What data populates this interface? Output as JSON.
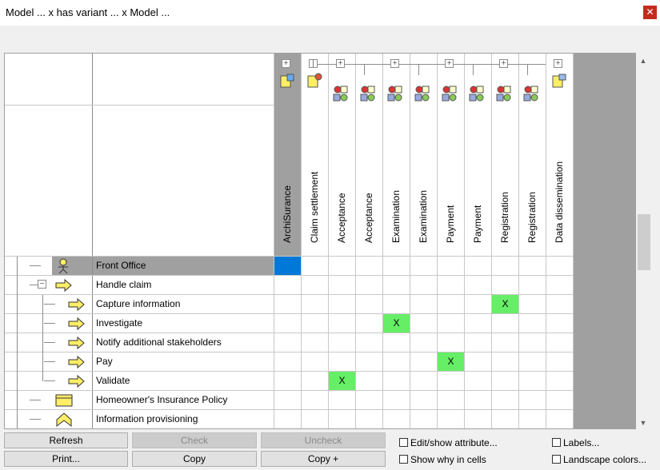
{
  "window": {
    "title": "Model ...  x has variant ...  x Model ...",
    "close_symbol": "✕"
  },
  "matrix": {
    "columns": [
      {
        "label": "ArchiSurance",
        "icon": "business-actor-service-icon",
        "expander": "+"
      },
      {
        "label": "Claim settlement",
        "icon": "business-service-icon",
        "expander": "−"
      },
      {
        "label": "Acceptance",
        "icon": "process-object-icon",
        "expander": "+"
      },
      {
        "label": "Acceptance",
        "icon": "process-object-icon",
        "expander": ""
      },
      {
        "label": "Examination",
        "icon": "process-object-icon",
        "expander": "+"
      },
      {
        "label": "Examination",
        "icon": "process-object-icon",
        "expander": ""
      },
      {
        "label": "Payment",
        "icon": "process-object-icon",
        "expander": "+"
      },
      {
        "label": "Payment",
        "icon": "process-object-icon",
        "expander": ""
      },
      {
        "label": "Registration",
        "icon": "process-object-icon",
        "expander": "+"
      },
      {
        "label": "Registration",
        "icon": "process-object-icon",
        "expander": ""
      },
      {
        "label": "Data dissemination",
        "icon": "data-object-icon",
        "expander": "+"
      }
    ],
    "rows": [
      {
        "label": "Front Office",
        "icon": "business-role-icon",
        "expander": ""
      },
      {
        "label": "Handle claim",
        "icon": "process-arrow-icon",
        "expander": "−"
      },
      {
        "label": "Capture information",
        "icon": "process-arrow-icon",
        "expander": ""
      },
      {
        "label": "Investigate",
        "icon": "process-arrow-icon",
        "expander": ""
      },
      {
        "label": "Notify additional stakeholders",
        "icon": "process-arrow-icon",
        "expander": ""
      },
      {
        "label": "Pay",
        "icon": "process-arrow-icon",
        "expander": ""
      },
      {
        "label": "Validate",
        "icon": "process-arrow-icon",
        "expander": ""
      },
      {
        "label": "Homeowner's Insurance Policy",
        "icon": "contract-icon",
        "expander": ""
      },
      {
        "label": "Information provisioning",
        "icon": "function-chevron-icon",
        "expander": ""
      }
    ],
    "marks": [
      {
        "row": 2,
        "col": 8,
        "text": "X"
      },
      {
        "row": 3,
        "col": 4,
        "text": "X"
      },
      {
        "row": 5,
        "col": 6,
        "text": "X"
      },
      {
        "row": 6,
        "col": 2,
        "text": "X"
      }
    ],
    "selected_cell": {
      "row": 0,
      "col": 0
    },
    "colors": {
      "mark": "#66ee66",
      "selected": "#0078d7",
      "header_highlight": "#a0a0a0"
    }
  },
  "buttons": {
    "refresh": "Refresh",
    "check": "Check",
    "uncheck": "Uncheck",
    "print": "Print...",
    "copy": "Copy",
    "copy_plus": "Copy +"
  },
  "options": {
    "edit_show_attribute": "Edit/show attribute...",
    "show_why": "Show why in cells",
    "labels": "Labels...",
    "landscape_colors": "Landscape colors..."
  },
  "scrollbar": {
    "up": "▲",
    "down": "▼"
  }
}
